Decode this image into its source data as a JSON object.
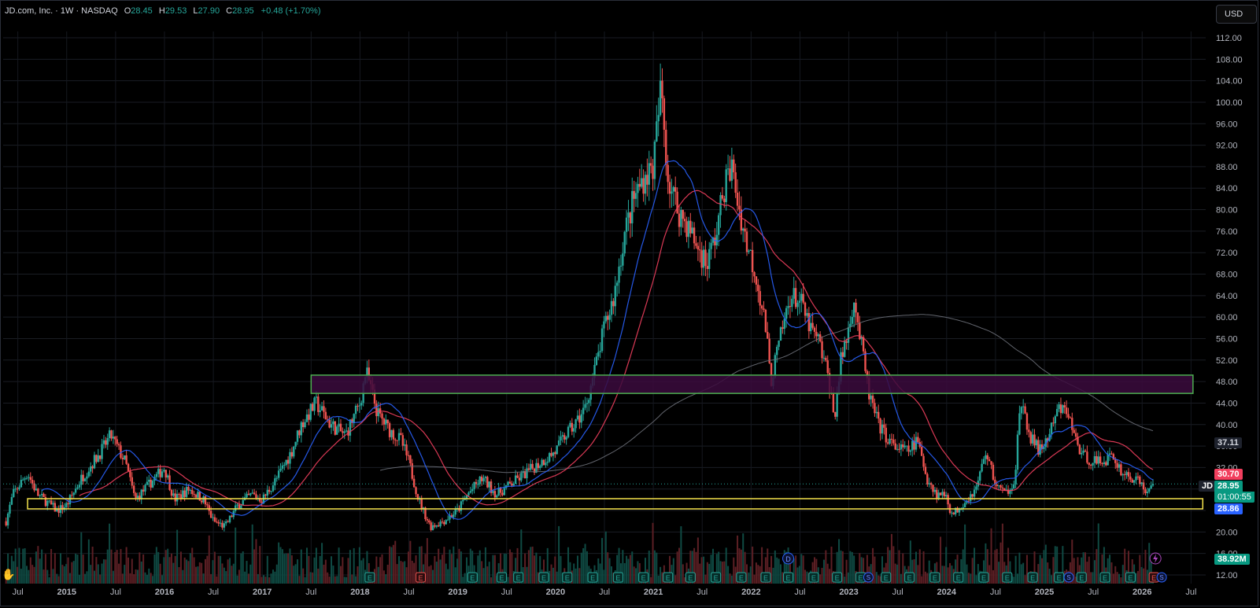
{
  "header": {
    "symbol_line": "JD.com, Inc. · 1W · NASDAQ",
    "o_label": "O",
    "o_value": "28.45",
    "h_label": "H",
    "h_value": "29.53",
    "l_label": "L",
    "l_value": "27.90",
    "c_label": "C",
    "c_value": "28.95",
    "change": "+0.48 (+1.70%)"
  },
  "currency_button": "USD",
  "price_tags": {
    "sma_long": "37.11",
    "sma_mid": "30.70",
    "symbol": "JD",
    "last_price": "28.95",
    "countdown": "01:00:55",
    "sma_fast": "28.86",
    "volume": "38.92M"
  },
  "colors": {
    "up": "#26a69a",
    "down": "#ef5350",
    "sma_fast": "#2962ff",
    "sma_mid": "#f23f5e",
    "sma_long": "#6b6f78",
    "resistance_zone_border": "#4caf50",
    "resistance_zone_fill": "#3b0b3d",
    "support_zone_border": "#f3e14b",
    "background": "#000000"
  },
  "event_markers": {
    "earnings_letter": "E",
    "dividend_letter": "D",
    "split_letter": "S"
  },
  "chart_data": {
    "type": "candlestick",
    "title": "",
    "interval": "1W",
    "ylim": [
      10,
      116
    ],
    "y_ticks": [
      "12.00",
      "16.00",
      "20.00",
      "24.00",
      "28.00",
      "32.00",
      "36.00",
      "40.00",
      "44.00",
      "48.00",
      "52.00",
      "56.00",
      "60.00",
      "64.00",
      "68.00",
      "72.00",
      "76.00",
      "80.00",
      "84.00",
      "88.00",
      "92.00",
      "96.00",
      "100.00",
      "104.00",
      "108.00",
      "112.00"
    ],
    "y_tick_values": [
      12,
      16,
      20,
      24,
      28,
      32,
      36,
      40,
      44,
      48,
      52,
      56,
      60,
      64,
      68,
      72,
      76,
      80,
      84,
      88,
      92,
      96,
      100,
      104,
      108,
      112
    ],
    "x_labels": [
      "Jul",
      "2015",
      "Jul",
      "2016",
      "Jul",
      "2017",
      "Jul",
      "2018",
      "Jul",
      "2019",
      "Jul",
      "2020",
      "Jul",
      "2021",
      "Jul",
      "2022",
      "Jul",
      "2023",
      "Jul",
      "2024",
      "Jul",
      "2025",
      "Jul",
      "2026",
      "Jul"
    ],
    "x_label_dates": [
      2014.5,
      2015.0,
      2015.5,
      2016.0,
      2016.5,
      2017.0,
      2017.5,
      2018.0,
      2018.5,
      2019.0,
      2019.5,
      2020.0,
      2020.5,
      2021.0,
      2021.5,
      2022.0,
      2022.5,
      2023.0,
      2023.5,
      2024.0,
      2024.5,
      2025.0,
      2025.5,
      2026.0,
      2026.5
    ],
    "xlim": [
      2014.35,
      2026.65
    ],
    "price_path": [
      [
        2014.38,
        22
      ],
      [
        2014.45,
        27
      ],
      [
        2014.6,
        31
      ],
      [
        2014.7,
        27
      ],
      [
        2014.9,
        24
      ],
      [
        2015.0,
        25
      ],
      [
        2015.15,
        30
      ],
      [
        2015.35,
        35
      ],
      [
        2015.45,
        38
      ],
      [
        2015.6,
        33
      ],
      [
        2015.7,
        26
      ],
      [
        2015.85,
        29
      ],
      [
        2016.0,
        32
      ],
      [
        2016.1,
        26
      ],
      [
        2016.25,
        28
      ],
      [
        2016.4,
        26
      ],
      [
        2016.5,
        22
      ],
      [
        2016.62,
        21
      ],
      [
        2016.75,
        25
      ],
      [
        2016.9,
        27
      ],
      [
        2017.0,
        26
      ],
      [
        2017.15,
        30
      ],
      [
        2017.3,
        35
      ],
      [
        2017.4,
        40
      ],
      [
        2017.55,
        44
      ],
      [
        2017.7,
        40
      ],
      [
        2017.85,
        38
      ],
      [
        2018.0,
        44
      ],
      [
        2018.06,
        50
      ],
      [
        2018.18,
        42
      ],
      [
        2018.3,
        39
      ],
      [
        2018.42,
        37
      ],
      [
        2018.5,
        33
      ],
      [
        2018.6,
        26
      ],
      [
        2018.72,
        21
      ],
      [
        2018.85,
        22
      ],
      [
        2019.0,
        24
      ],
      [
        2019.1,
        27
      ],
      [
        2019.25,
        30
      ],
      [
        2019.4,
        27
      ],
      [
        2019.55,
        29
      ],
      [
        2019.7,
        31
      ],
      [
        2019.85,
        33
      ],
      [
        2020.0,
        35
      ],
      [
        2020.1,
        38
      ],
      [
        2020.2,
        40
      ],
      [
        2020.3,
        43
      ],
      [
        2020.4,
        50
      ],
      [
        2020.5,
        58
      ],
      [
        2020.6,
        64
      ],
      [
        2020.7,
        75
      ],
      [
        2020.8,
        82
      ],
      [
        2020.9,
        86
      ],
      [
        2021.0,
        88
      ],
      [
        2021.08,
        103
      ],
      [
        2021.15,
        86
      ],
      [
        2021.25,
        80
      ],
      [
        2021.35,
        77
      ],
      [
        2021.45,
        73
      ],
      [
        2021.55,
        70
      ],
      [
        2021.65,
        76
      ],
      [
        2021.72,
        84
      ],
      [
        2021.8,
        88
      ],
      [
        2021.88,
        80
      ],
      [
        2021.95,
        74
      ],
      [
        2022.05,
        68
      ],
      [
        2022.15,
        58
      ],
      [
        2022.2,
        48
      ],
      [
        2022.3,
        56
      ],
      [
        2022.4,
        64
      ],
      [
        2022.5,
        63
      ],
      [
        2022.6,
        58
      ],
      [
        2022.7,
        55
      ],
      [
        2022.8,
        48
      ],
      [
        2022.85,
        41
      ],
      [
        2022.92,
        52
      ],
      [
        2023.0,
        58
      ],
      [
        2023.05,
        64
      ],
      [
        2023.1,
        58
      ],
      [
        2023.2,
        46
      ],
      [
        2023.3,
        40
      ],
      [
        2023.45,
        36
      ],
      [
        2023.6,
        35
      ],
      [
        2023.7,
        37
      ],
      [
        2023.8,
        30
      ],
      [
        2023.9,
        27
      ],
      [
        2024.0,
        27
      ],
      [
        2024.05,
        23
      ],
      [
        2024.15,
        25
      ],
      [
        2024.3,
        28
      ],
      [
        2024.4,
        35
      ],
      [
        2024.5,
        29
      ],
      [
        2024.6,
        27
      ],
      [
        2024.7,
        30
      ],
      [
        2024.75,
        44
      ],
      [
        2024.85,
        38
      ],
      [
        2024.95,
        35
      ],
      [
        2025.05,
        38
      ],
      [
        2025.15,
        43
      ],
      [
        2025.25,
        42
      ],
      [
        2025.3,
        38
      ],
      [
        2025.4,
        34
      ],
      [
        2025.55,
        33
      ],
      [
        2025.7,
        34
      ],
      [
        2025.8,
        31
      ],
      [
        2025.9,
        30
      ],
      [
        2026.0,
        29
      ],
      [
        2026.05,
        27
      ],
      [
        2026.12,
        28.95
      ]
    ],
    "last_close": 28.95,
    "series": [
      {
        "name": "SMA fast",
        "value": 28.86
      },
      {
        "name": "SMA mid",
        "value": 30.7
      },
      {
        "name": "SMA long",
        "value": 37.11
      }
    ],
    "zones": [
      {
        "kind": "resistance",
        "from_date": 2017.5,
        "to_date": 2026.52,
        "low": 45.8,
        "high": 49.2
      },
      {
        "kind": "support",
        "from_date": 2014.6,
        "to_date": 2026.62,
        "low": 24.3,
        "high": 26.2
      }
    ],
    "last_volume": "38.92M",
    "earnings_dates": [
      2018.1,
      2018.62,
      2019.15,
      2019.45,
      2019.62,
      2019.88,
      2020.12,
      2020.38,
      2020.64,
      2020.9,
      2021.15,
      2021.38,
      2021.64,
      2021.9,
      2022.15,
      2022.38,
      2022.64,
      2022.88,
      2023.12,
      2023.38,
      2023.62,
      2023.88,
      2024.12,
      2024.38,
      2024.62,
      2024.88,
      2025.15,
      2025.38,
      2025.62,
      2025.88,
      2026.12
    ],
    "earnings_down_dates": [
      2018.62,
      2026.12
    ],
    "dividend_dates": [
      2022.38
    ],
    "split_dates": [
      2023.2,
      2025.25,
      2026.2
    ]
  }
}
